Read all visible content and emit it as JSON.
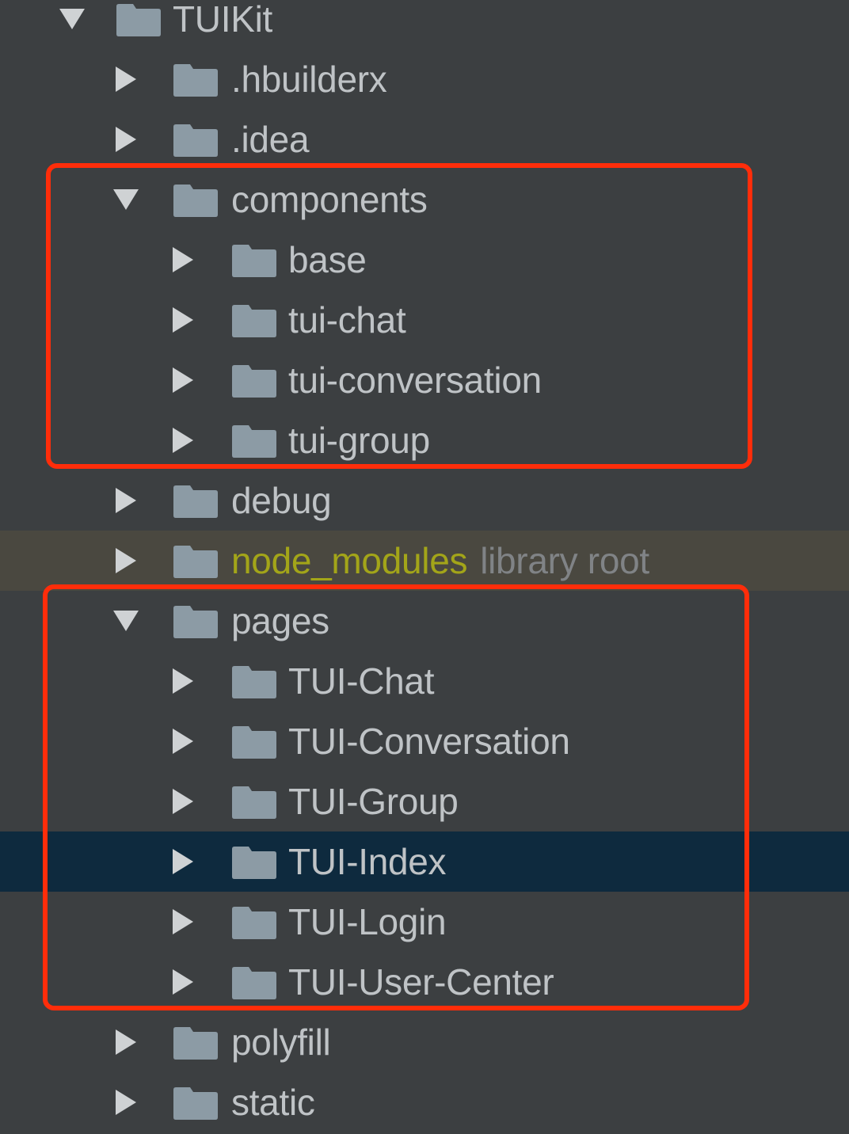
{
  "colors": {
    "background": "#3c3f41",
    "text": "#bfc3c6",
    "folder_icon": "#8c9ba5",
    "expand_arrow": "#cfd2d4",
    "library_root_row": "#4a4840",
    "library_name": "#a3a519",
    "library_suffix": "#808386",
    "selected_row": "#0e2a3e",
    "highlight_box": "#ff2d0a"
  },
  "icons": {
    "collapsed": "triangle-right-icon",
    "expanded": "triangle-down-icon",
    "folder": "folder-icon"
  },
  "tree": {
    "root": {
      "label": "TUIKit",
      "expanded": true
    },
    "items": [
      {
        "label": ".hbuilderx",
        "depth": 1,
        "expanded": false
      },
      {
        "label": ".idea",
        "depth": 1,
        "expanded": false
      },
      {
        "label": "components",
        "depth": 1,
        "expanded": true
      },
      {
        "label": "base",
        "depth": 2,
        "expanded": false
      },
      {
        "label": "tui-chat",
        "depth": 2,
        "expanded": false
      },
      {
        "label": "tui-conversation",
        "depth": 2,
        "expanded": false
      },
      {
        "label": "tui-group",
        "depth": 2,
        "expanded": false
      },
      {
        "label": "debug",
        "depth": 1,
        "expanded": false
      },
      {
        "label": "node_modules",
        "suffix": "library root",
        "depth": 1,
        "expanded": false,
        "library_root": true
      },
      {
        "label": "pages",
        "depth": 1,
        "expanded": true
      },
      {
        "label": "TUI-Chat",
        "depth": 2,
        "expanded": false
      },
      {
        "label": "TUI-Conversation",
        "depth": 2,
        "expanded": false
      },
      {
        "label": "TUI-Group",
        "depth": 2,
        "expanded": false
      },
      {
        "label": "TUI-Index",
        "depth": 2,
        "expanded": false,
        "selected": true
      },
      {
        "label": "TUI-Login",
        "depth": 2,
        "expanded": false
      },
      {
        "label": "TUI-User-Center",
        "depth": 2,
        "expanded": false
      },
      {
        "label": "polyfill",
        "depth": 1,
        "expanded": false
      },
      {
        "label": "static",
        "depth": 1,
        "expanded": false
      }
    ]
  },
  "highlights": [
    {
      "name": "components-highlight",
      "rows": [
        3,
        7
      ]
    },
    {
      "name": "pages-highlight",
      "rows": [
        10,
        16
      ]
    }
  ]
}
